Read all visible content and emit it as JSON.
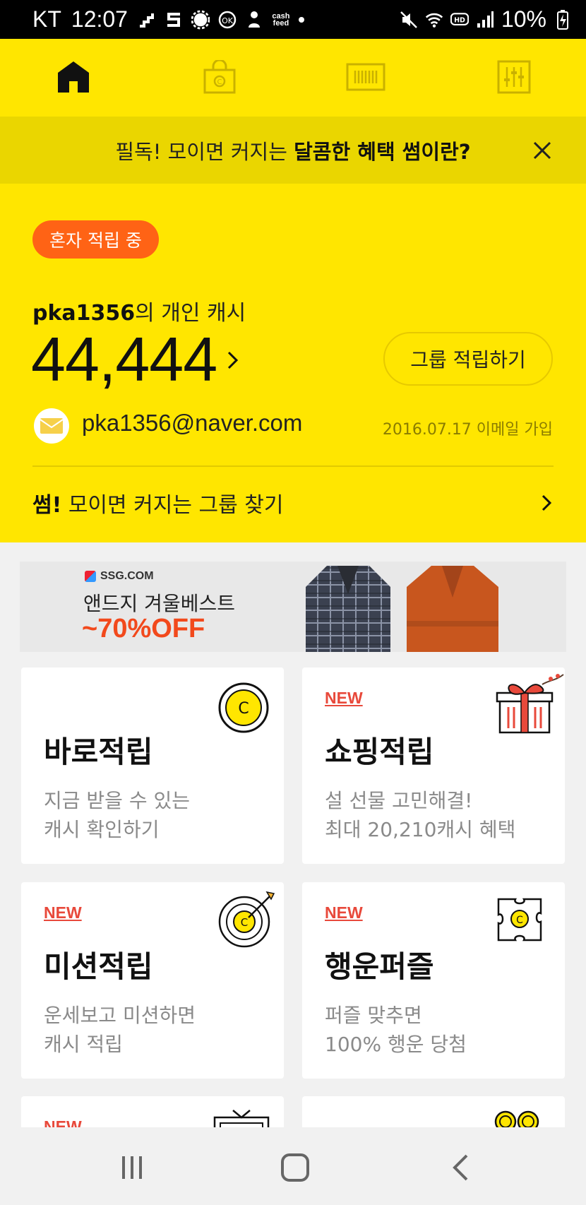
{
  "status_bar": {
    "carrier": "KT",
    "time": "12:07",
    "battery": "10%",
    "cashfeed_label": "cash feed"
  },
  "top_nav": {
    "items": [
      "home-icon",
      "shopping-bag-icon",
      "barcode-icon",
      "settings-sliders-icon"
    ],
    "active": "home-icon"
  },
  "notice": {
    "prefix": "필독! 모이면 커지는 ",
    "highlight": "달콤한 혜택 썸이란?"
  },
  "profile": {
    "badge": "혼자 적립 중",
    "user_id": "pka1356",
    "cash_title_suffix": "의 개인 캐시",
    "amount": "44,444",
    "group_button": "그룹 적립하기",
    "email": "pka1356@naver.com",
    "joined": "2016.07.17 이메일 가입",
    "find_group_bold": "썸!",
    "find_group_text": " 모이면 커지는 그룹 찾기"
  },
  "banner": {
    "logo": "SSG.COM",
    "title": "앤드지 겨울베스트",
    "discount": "~70%OFF"
  },
  "cards": [
    {
      "title": "바로적립",
      "new": "",
      "desc1": "지금 받을 수 있는",
      "desc2": "캐시 확인하기",
      "icon": "coin-icon"
    },
    {
      "title": "쇼핑적립",
      "new": "NEW",
      "desc1": "설 선물 고민해결!",
      "desc2": "최대 20,210캐시 혜택",
      "icon": "gift-box-icon"
    },
    {
      "title": "미션적립",
      "new": "NEW",
      "desc1": "운세보고 미션하면",
      "desc2": "캐시 적립",
      "icon": "target-icon"
    },
    {
      "title": "행운퍼즐",
      "new": "NEW",
      "desc1": "퍼즐 맞추면",
      "desc2": "100% 행운 당첨",
      "icon": "puzzle-icon"
    },
    {
      "title": "",
      "new": "NEW",
      "desc1": "",
      "desc2": "",
      "icon": "tv-icon"
    },
    {
      "title": "",
      "new": "",
      "desc1": "",
      "desc2": "",
      "icon": "coins-icon"
    }
  ],
  "bottom_nav": [
    "recent-apps-icon",
    "home-button-icon",
    "back-icon"
  ],
  "colors": {
    "primary_yellow": "#ffe600",
    "notice_yellow": "#ead600",
    "badge_orange": "#ff6315",
    "new_red": "#e8493b"
  }
}
